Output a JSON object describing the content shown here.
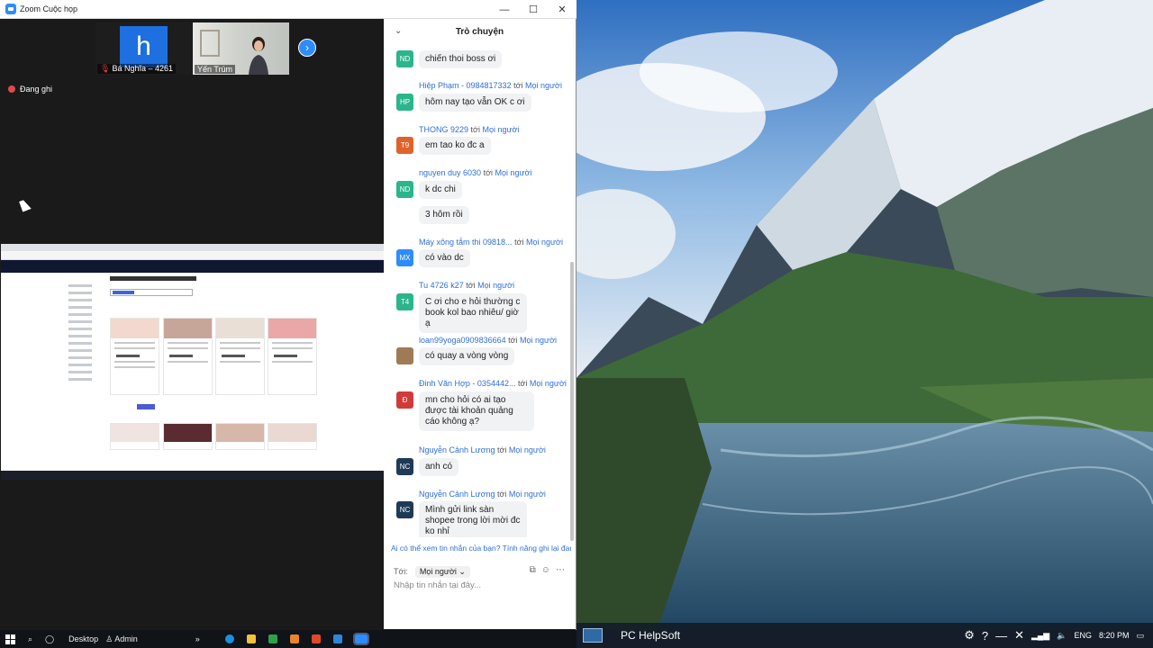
{
  "window": {
    "title": "Zoom Cuộc họp",
    "minimize": "—",
    "maximize": "☐",
    "close": "✕"
  },
  "video": {
    "participants": [
      {
        "initial": "h",
        "name": "Bá Nghĩa – 4261",
        "muted": true
      },
      {
        "name": "Yến Trúm"
      }
    ],
    "next_icon": "›",
    "recording_label": "Đang ghi"
  },
  "chat": {
    "title": "Trò chuyện",
    "collapse_icon": "⌄",
    "to_word": "tới",
    "messages": [
      {
        "initials": "ND",
        "color": "#2bb58a",
        "bubbles": [
          "chiến thoi boss ơi"
        ]
      },
      {
        "sender": "Hiệp Phạm - 0984817332",
        "recipient": "Mọi người",
        "initials": "HP",
        "color": "#2bb58a",
        "bubbles": [
          "hôm nay tạo vẫn OK c ơi"
        ]
      },
      {
        "sender": "THONG 9229",
        "recipient": "Mọi người",
        "initials": "T9",
        "color": "#e0622b",
        "bubbles": [
          "em tao ko đc a"
        ]
      },
      {
        "sender": "nguyen duy 6030",
        "recipient": "Mọi người",
        "initials": "ND",
        "color": "#2bb58a",
        "bubbles": [
          "k dc chi",
          "3 hôm rồi"
        ]
      },
      {
        "sender": "Máy xông tắm thi 09818...",
        "recipient": "Mọi người",
        "initials": "MX",
        "color": "#2d8cff",
        "bubbles": [
          "có vào dc"
        ]
      },
      {
        "sender": "Tu 4726 k27",
        "recipient": "Mọi người",
        "initials": "T4",
        "color": "#2bb58a",
        "bubbles": [
          "C ơi cho e hỏi thường c book kol bao nhiêu/ giờ ạ"
        ]
      },
      {
        "sender": "loan99yoga0909836664",
        "recipient": "Mọi người",
        "initials": "",
        "color": "#a07a55",
        "bubbles": [
          "có quay a vòng vòng"
        ]
      },
      {
        "sender": "Đinh Văn Hợp - 0354442...",
        "recipient": "Mọi người",
        "initials": "Đ",
        "color": "#d23a3a",
        "bubbles": [
          "mn cho hỏi có ai tạo được tài khoản quảng cáo không ạ?"
        ]
      },
      {
        "sender": "Nguyễn Cảnh Lương",
        "recipient": "Mọi người",
        "initials": "NC",
        "color": "#1f3a57",
        "bubbles": [
          "anh có"
        ]
      },
      {
        "sender": "Nguyễn Cảnh Lương",
        "recipient": "Mọi người",
        "initials": "NC",
        "color": "#1f3a57",
        "bubbles": [
          "Mình gửi link sàn shopee trong lời mời đc ko nhỉ"
        ]
      }
    ],
    "notice": "Ai có thể xem tin nhắn của bạn? Tính năng ghi lại đang được bật",
    "to_label": "Tới:",
    "to_value": "Mọi người",
    "input_placeholder": "Nhập tin nhắn tại đây..."
  },
  "taskbar": {
    "desktop_label": "Desktop",
    "user_label": "Admin",
    "chevron": "»"
  },
  "desktop": {
    "pc_name": "PC HelpSoft",
    "lang": "ENG",
    "time": "8:20 PM"
  }
}
